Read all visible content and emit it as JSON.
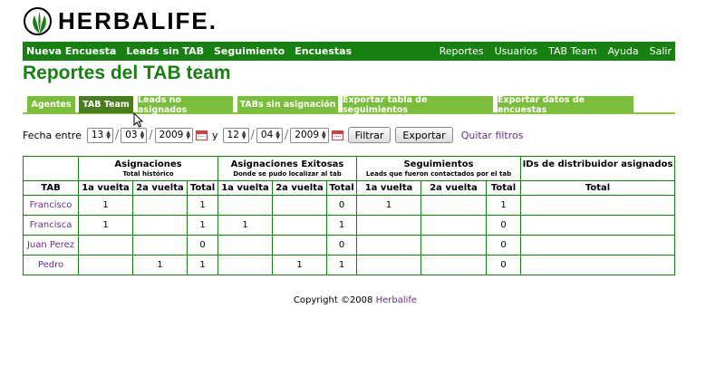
{
  "logo": {
    "text": "HERBALIFE."
  },
  "nav": {
    "left": [
      "Nueva Encuesta",
      "Leads sin TAB",
      "Seguimiento",
      "Encuestas"
    ],
    "right": [
      "Reportes",
      "Usuarios",
      "TAB Team",
      "Ayuda",
      "Salir"
    ]
  },
  "page_title": "Reportes del TAB team",
  "tabs": [
    "Agentes",
    "TAB Team",
    "Leads no asignados",
    "TABs sin asignación",
    "Exportar tabla de seguimientos",
    "Exportar datos de encuestas"
  ],
  "active_tab": "TAB Team",
  "filter": {
    "label": "Fecha entre",
    "from": {
      "day": "13",
      "month": "03",
      "year": "2009"
    },
    "and_label": "y",
    "to": {
      "day": "12",
      "month": "04",
      "year": "2009"
    },
    "filter_button": "Filtrar",
    "export_button": "Exportar",
    "clear_link": "Quitar filtros"
  },
  "table": {
    "groups": [
      {
        "title": "Asignaciones",
        "subtitle": "Total histórico"
      },
      {
        "title": "Asignaciones Exitosas",
        "subtitle": "Donde se pudo localizar al tab"
      },
      {
        "title": "Seguimientos",
        "subtitle": "Leads que fueron contactados por el tab"
      },
      {
        "title": "IDs de distribuidor asignados",
        "subtitle": ""
      }
    ],
    "subheaders": [
      "TAB",
      "1a vuelta",
      "2a vuelta",
      "Total",
      "1a vuelta",
      "2a vuelta",
      "Total",
      "1a vuelta",
      "2a vuelta",
      "Total",
      "Total"
    ],
    "rows": [
      {
        "name": "Francisco",
        "cells": [
          "1",
          "",
          "1",
          "",
          "",
          "0",
          "1",
          "",
          "1",
          ""
        ]
      },
      {
        "name": "Francisca",
        "cells": [
          "1",
          "",
          "1",
          "1",
          "",
          "1",
          "",
          "",
          "0",
          ""
        ]
      },
      {
        "name": "Juan Perez",
        "cells": [
          "",
          "",
          "0",
          "",
          "",
          "0",
          "",
          "",
          "0",
          ""
        ]
      },
      {
        "name": "Pedro",
        "cells": [
          "",
          "1",
          "1",
          "",
          "1",
          "1",
          "",
          "",
          "0",
          ""
        ]
      }
    ]
  },
  "footer": {
    "copyright": "Copyright ©2008 ",
    "brand": "Herbalife"
  },
  "colors": {
    "brand_green": "#168011",
    "tab_green": "#7abe3c",
    "tab_active": "#4a7d1e",
    "link_purple": "#6a2d91"
  },
  "icons": [
    "herbalife-logo-icon",
    "calendar-icon",
    "mouse-cursor-icon",
    "spinner-arrows-icon"
  ]
}
